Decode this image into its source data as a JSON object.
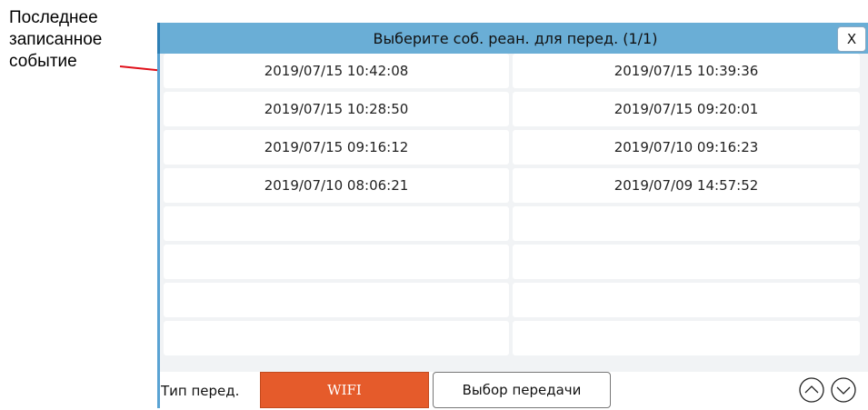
{
  "annotation": {
    "lines": [
      "Последнее",
      "записанное",
      "событие"
    ]
  },
  "dialog": {
    "title": "Выберите соб. реан. для перед. (1/1)",
    "close_label": "X",
    "events": [
      [
        "2019/07/15 10:42:08",
        "2019/07/15 10:39:36"
      ],
      [
        "2019/07/15 10:28:50",
        "2019/07/15 09:20:01"
      ],
      [
        "2019/07/15 09:16:12",
        "2019/07/10 09:16:23"
      ],
      [
        "2019/07/10 08:06:21",
        "2019/07/09 14:57:52"
      ],
      [
        "",
        ""
      ],
      [
        "",
        ""
      ],
      [
        "",
        ""
      ],
      [
        "",
        ""
      ]
    ],
    "footer": {
      "type_label": "Тип перед.",
      "wifi_label": "WIFI",
      "select_label": "Выбор передачи",
      "scroll_up_icon": "chevron-up-circle-icon",
      "scroll_down_icon": "chevron-down-circle-icon"
    }
  },
  "colors": {
    "titlebar": "#6aaed6",
    "accent_orange": "#e55b2b",
    "annotation_line": "#e0101a"
  }
}
